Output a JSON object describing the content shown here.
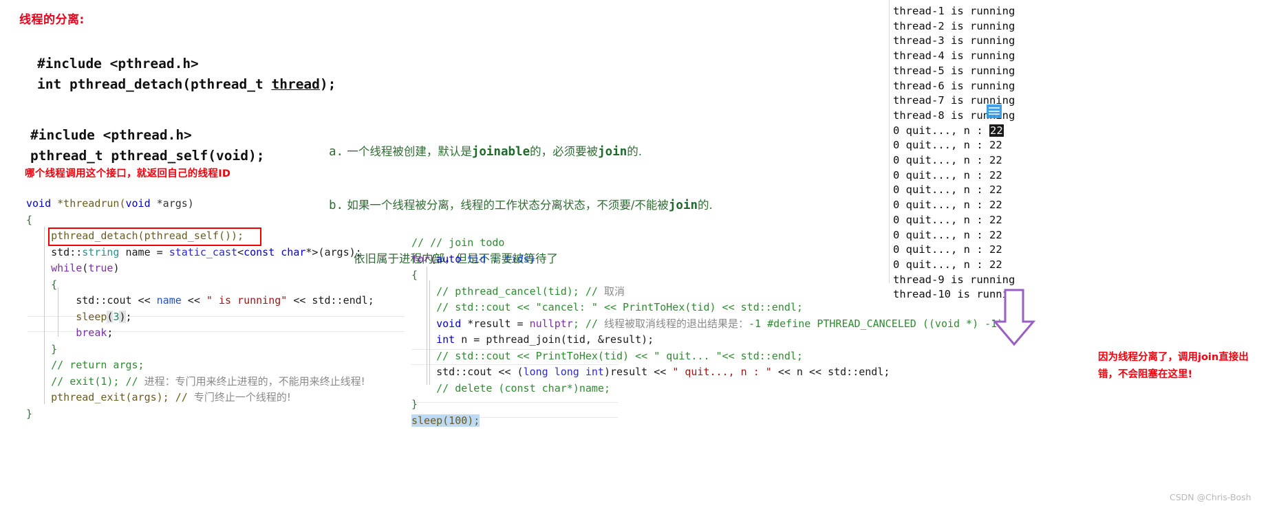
{
  "heading": "线程的分离:",
  "api_detach": {
    "line1": "#include <pthread.h>",
    "line2_pre": "int pthread_detach(pthread_t ",
    "line2_arg": "thread",
    "line2_post": ");"
  },
  "api_self": {
    "line1": "#include <pthread.h>",
    "line2": "pthread_t pthread_self(void);"
  },
  "annotations": {
    "self_note": "哪个线程调用这个接口，就返回自己的线程ID",
    "bottom_note_line1": "因为线程分离了，调用join直接出",
    "bottom_note_line2": "错，不会阻塞在这里!"
  },
  "green_notes": {
    "a_label": "a.",
    "a_text_1": " 一个线程被创建，默认是",
    "a_kw_1": "joinable",
    "a_text_2": "的，必须要被",
    "a_kw_2": "join",
    "a_text_3": "的.",
    "b_label": "b.",
    "b_text_1": " 如果一个线程被分离，线程的工作状态分离状态，不须要/不能被",
    "b_kw_1": "join",
    "b_text_2": "的.",
    "c_text": "依旧属于进程内部，但是不需要被等待了"
  },
  "code_left": {
    "l1_kw": "void",
    "l1_rest": " *threadrun(",
    "l1_kw2": "void",
    "l1_rest2": " *args)",
    "l2": "{",
    "l3": "    pthread_detach(pthread_self());",
    "l4_a": "    std::",
    "l4_b": "string",
    "l4_c": " name = ",
    "l4_d": "static_cast",
    "l4_e": "<",
    "l4_f": "const char",
    "l4_g": "*>(args);",
    "l5_kw": "    while",
    "l5_a": "(",
    "l5_b": "true",
    "l5_c": ")",
    "l6": "    {",
    "l7_a": "        std::cout << ",
    "l7_b": "name",
    "l7_c": " << ",
    "l7_str": "\" is running\"",
    "l7_d": " << std::endl;",
    "l8_a": "        sleep",
    "l8_b": "(",
    "l8_num": "3",
    "l8_c": ")",
    "l8_d": ";",
    "l9_kw": "        break",
    "l9_rest": ";",
    "l10": "    }",
    "l11": "    // return args;",
    "l12_code": "    // exit(1); // ",
    "l12_cjk": "进程：专门用来终止进程的，不能用来终止线程!",
    "l13_code": "    pthread_exit(args); // ",
    "l13_cjk": "专门终止一个线程的!",
    "l14": "}"
  },
  "code_right": {
    "r1": "// // join todo",
    "r2_kw": "for",
    "r2_a": "(",
    "r2_b": "auto",
    "r2_c": " tid : tids)",
    "r3": "{",
    "r4_code": "    // pthread_cancel(tid); // ",
    "r4_cjk": "取消",
    "r5": "    // std::cout << \"cancel: \" << PrintToHex(tid) << std::endl;",
    "r6_kw": "    void",
    "r6_a": " *result = ",
    "r6_b": "nullptr",
    "r6_c": "; // ",
    "r6_cjk": "线程被取消线程的退出结果是：",
    "r6_tail": "-1 #define PTHREAD_CANCELED ((void *) -1)",
    "r7_kw": "    int",
    "r7_rest": " n = pthread_join(tid, &result);",
    "r8": "    // std::cout << PrintToHex(tid) << \" quit... \"<< std::endl;",
    "r9_a": "    std::cout << (",
    "r9_kw": "long long int",
    "r9_b": ")result << ",
    "r9_str": "\" quit..., n : \"",
    "r9_c": " << n << std::endl;",
    "r10": "    // delete (const char*)name;",
    "r11": "}",
    "r12": "sleep(100);"
  },
  "terminal": {
    "lines": [
      "thread-1 is running",
      "thread-2 is running",
      "thread-3 is running",
      "thread-4 is running",
      "thread-5 is running",
      "thread-6 is running",
      "thread-7 is running",
      "thread-8 is running"
    ],
    "quit_prefix": "0 quit..., n : ",
    "quit_value": "22",
    "quit_count": 10,
    "tail_lines": [
      "thread-9 is running",
      "thread-10 is running"
    ]
  },
  "watermark": "CSDN @Chris-Bosh",
  "colors": {
    "red": "#f2000c",
    "green": "#2f6b33",
    "purple_arrow_fill": "#ffffff",
    "purple_arrow_stroke": "#9a5fc4",
    "terminal_highlight": "#1a1a1a",
    "cursor_blue": "#3399e6"
  }
}
